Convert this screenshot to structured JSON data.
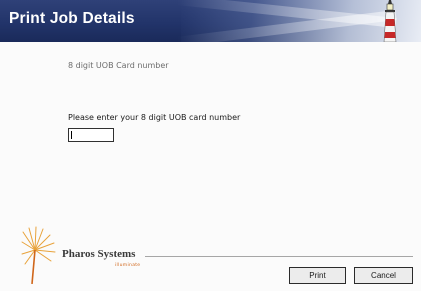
{
  "header": {
    "title": "Print Job Details"
  },
  "form": {
    "hint": "8 digit UOB Card number",
    "prompt": "Please enter your 8 digit UOB card number",
    "card_value": ""
  },
  "brand": {
    "name": "Pharos Systems",
    "tagline": "illuminate"
  },
  "buttons": {
    "print": "Print",
    "cancel": "Cancel"
  },
  "colors": {
    "header": "#22346a",
    "tagline": "#d0661a"
  }
}
